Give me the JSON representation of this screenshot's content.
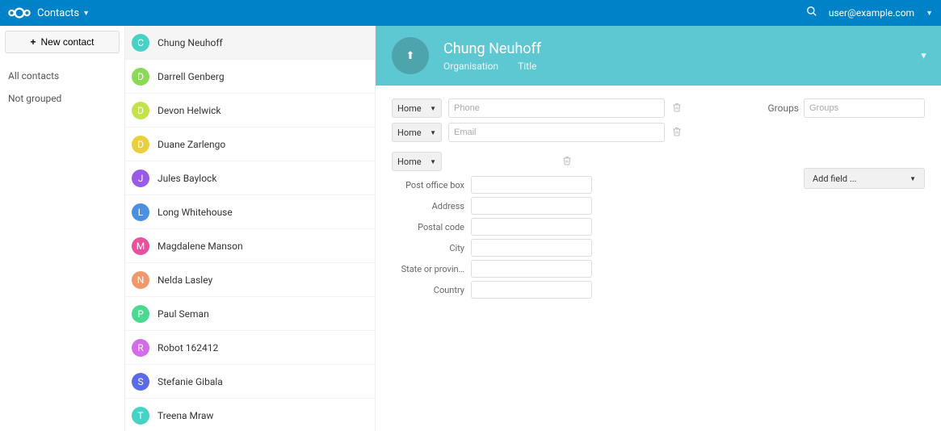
{
  "topbar": {
    "app_name": "Contacts",
    "user_label": "user@example.com"
  },
  "sidebar": {
    "new_contact_label": "New contact",
    "links": [
      {
        "label": "All contacts"
      },
      {
        "label": "Not grouped"
      }
    ]
  },
  "contacts": [
    {
      "initial": "C",
      "name": "Chung Neuhoff",
      "color": "#46d2c4",
      "selected": true
    },
    {
      "initial": "D",
      "name": "Darrell Genberg",
      "color": "#8ad957",
      "selected": false
    },
    {
      "initial": "D",
      "name": "Devon Helwick",
      "color": "#c4e34a",
      "selected": false
    },
    {
      "initial": "D",
      "name": "Duane Zarlengo",
      "color": "#e9cf3e",
      "selected": false
    },
    {
      "initial": "J",
      "name": "Jules Baylock",
      "color": "#9b59e8",
      "selected": false
    },
    {
      "initial": "L",
      "name": "Long Whitehouse",
      "color": "#4a90e2",
      "selected": false
    },
    {
      "initial": "M",
      "name": "Magdalene Manson",
      "color": "#e8519e",
      "selected": false
    },
    {
      "initial": "N",
      "name": "Nelda Lasley",
      "color": "#f0986b",
      "selected": false
    },
    {
      "initial": "P",
      "name": "Paul Seman",
      "color": "#4ad991",
      "selected": false
    },
    {
      "initial": "R",
      "name": "Robot 162412",
      "color": "#d46be8",
      "selected": false
    },
    {
      "initial": "S",
      "name": "Stefanie Gibala",
      "color": "#5b6be8",
      "selected": false
    },
    {
      "initial": "T",
      "name": "Treena Mraw",
      "color": "#46d2c4",
      "selected": false
    }
  ],
  "details": {
    "header": {
      "name": "Chung Neuhoff",
      "organisation_placeholder": "Organisation",
      "title_placeholder": "Title",
      "avatar_upload_glyph": "⬆"
    },
    "phone": {
      "type_label": "Home",
      "placeholder": "Phone"
    },
    "email": {
      "type_label": "Home",
      "placeholder": "Email"
    },
    "address": {
      "type_label": "Home",
      "labels": {
        "po": "Post office box",
        "addr": "Address",
        "postal": "Postal code",
        "city": "City",
        "state": "State or provin…",
        "country": "Country"
      }
    },
    "groups": {
      "label": "Groups",
      "placeholder": "Groups"
    },
    "addfield_label": "Add field ..."
  }
}
